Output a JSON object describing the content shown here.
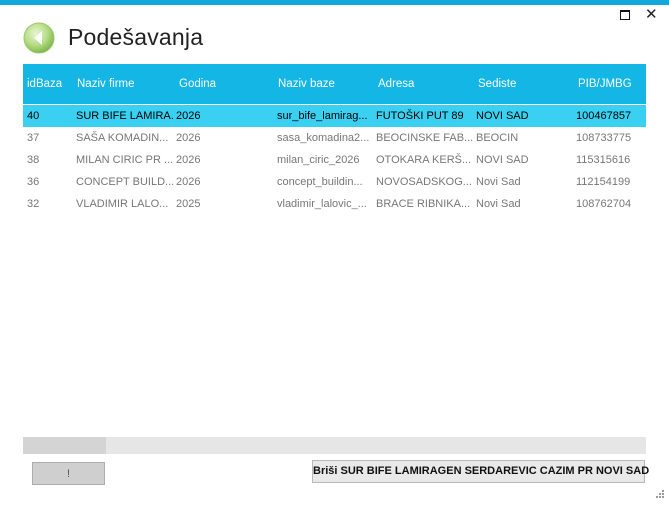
{
  "window": {
    "title": "Podešavanja",
    "maximize_icon": "maximize-icon",
    "close_glyph": "✕"
  },
  "back_icon": "back-arrow-icon",
  "grid": {
    "columns": [
      "idBaza",
      "Naziv firme",
      "Godina",
      "Naziv baze",
      "Adresa",
      "Sediste",
      "PIB/JMBG"
    ],
    "rows": [
      {
        "id": "40",
        "firma": "SUR BIFE LAMIRA...",
        "godina": "2026",
        "baza": "sur_bife_lamirag...",
        "adresa": "FUTOŠKI PUT 89",
        "sediste": "NOVI SAD",
        "pib": "100467857",
        "selected": true
      },
      {
        "id": "37",
        "firma": "SAŠA KOMADIN...",
        "godina": "2026",
        "baza": "sasa_komadina2...",
        "adresa": "BEOCINSKE FAB...",
        "sediste": "BEOCIN",
        "pib": "108733775",
        "selected": false
      },
      {
        "id": "38",
        "firma": "MILAN CIRIC PR ...",
        "godina": "2026",
        "baza": "milan_ciric_2026",
        "adresa": "OTOKARA KERŠ...",
        "sediste": "NOVI SAD",
        "pib": "115315616",
        "selected": false
      },
      {
        "id": "36",
        "firma": "CONCEPT BUILD...",
        "godina": "2026",
        "baza": "concept_buildin...",
        "adresa": "NOVOSADSKOG...",
        "sediste": "Novi Sad",
        "pib": "112154199",
        "selected": false
      },
      {
        "id": "32",
        "firma": "VLADIMIR LALO...",
        "godina": "2025",
        "baza": "vladimir_lalovic_...",
        "adresa": "BRACE RIBNIKA...",
        "sediste": "Novi Sad",
        "pib": "108762704",
        "selected": false
      }
    ]
  },
  "buttons": {
    "exclaim_label": "!",
    "delete_label": "Briši SUR BIFE LAMIRAGEN SERDAREVIC CAZIM PR NOVI SAD"
  },
  "colors": {
    "accent": "#13b6e4",
    "selected_row": "#39d0f2"
  }
}
